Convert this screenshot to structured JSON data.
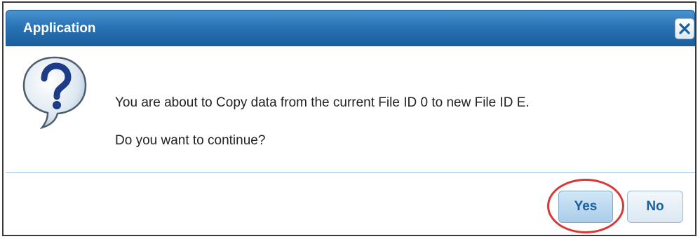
{
  "dialog": {
    "title": "Application",
    "close_icon": "close-icon",
    "message_icon": "question-icon",
    "message_line1": "You are about to Copy data from the current File ID 0 to new File ID E.",
    "message_line2": "Do you want to continue?",
    "buttons": {
      "yes_label": "Yes",
      "no_label": "No"
    },
    "highlight_color": "#d9383a",
    "titlebar_color": "#2a73b5"
  }
}
